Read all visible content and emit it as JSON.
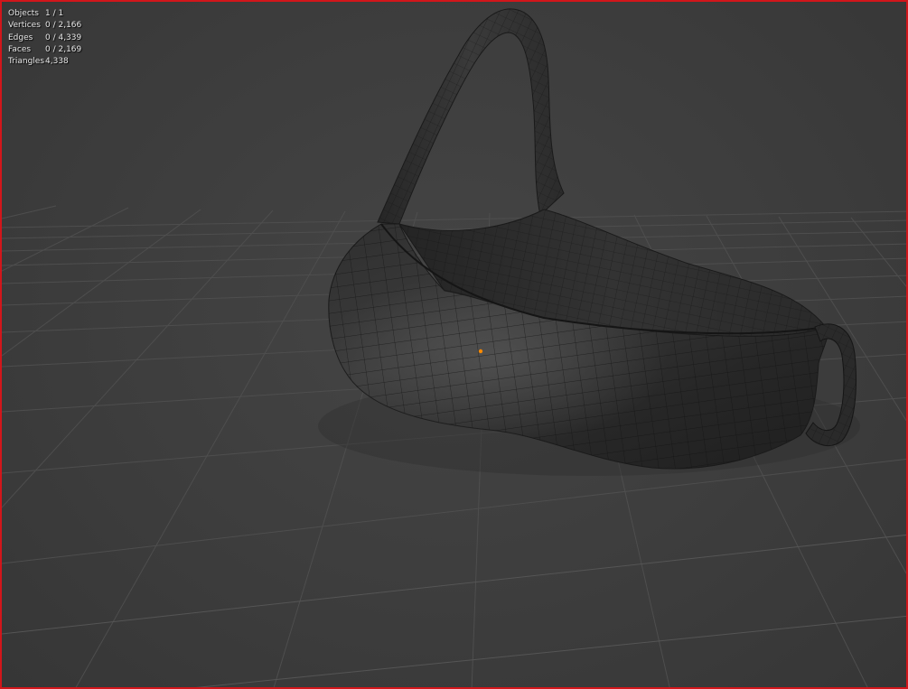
{
  "viewport": {
    "active_border_color": "#d2161b",
    "background_color": "#3d3d3d",
    "grid_color": "#4f4f4f",
    "mesh_color": "#262626",
    "wire_color": "#0f0f0f",
    "origin_color": "#ff8a00"
  },
  "stats": [
    {
      "label": "Objects",
      "value": "1 / 1"
    },
    {
      "label": "Vertices",
      "value": "0 / 2,166"
    },
    {
      "label": "Edges",
      "value": "0 / 4,339"
    },
    {
      "label": "Faces",
      "value": "0 / 2,169"
    },
    {
      "label": "Triangles",
      "value": "4,338"
    }
  ],
  "object": {
    "icon": "bag-mesh-icon",
    "origin_icon": "object-origin-dot-icon"
  }
}
